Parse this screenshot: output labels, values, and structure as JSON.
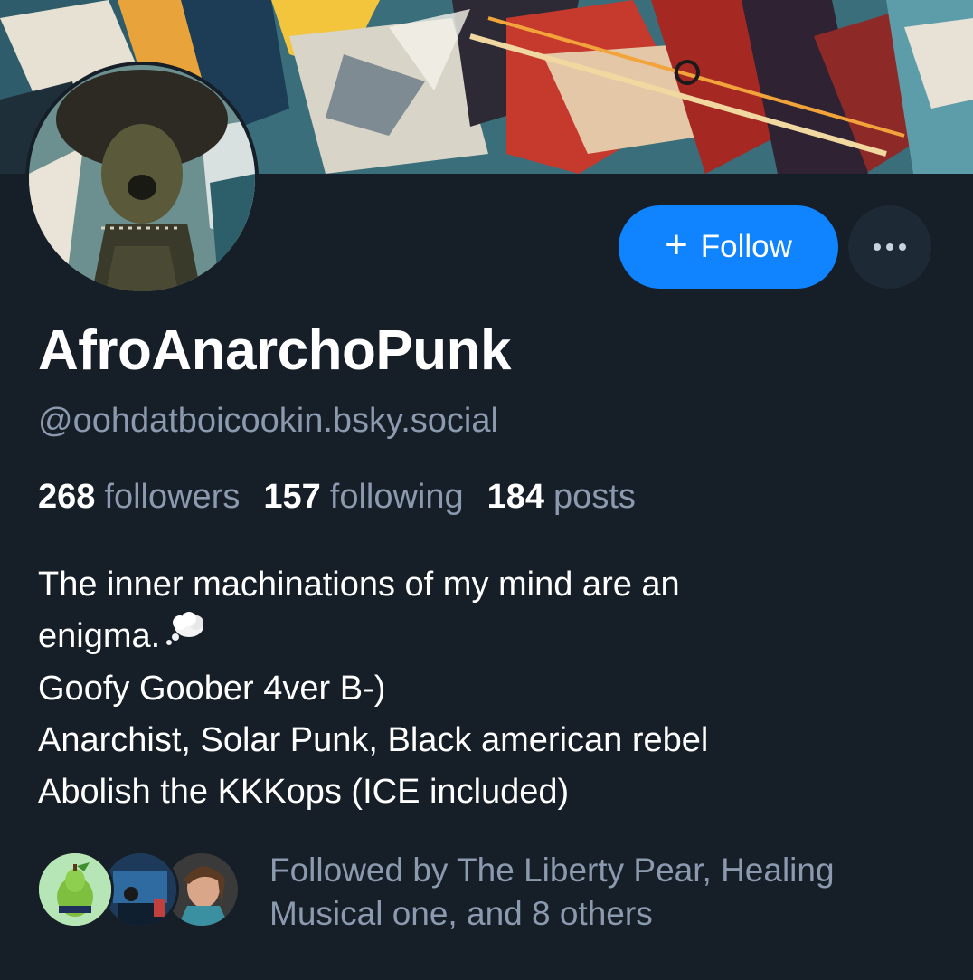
{
  "profile": {
    "display_name": "AfroAnarchoPunk",
    "handle": "@oohdatboicookin.bsky.social"
  },
  "actions": {
    "follow_label": "Follow",
    "more_icon": "ellipsis-icon"
  },
  "stats": {
    "followers_count": "268",
    "followers_label": "followers",
    "following_count": "157",
    "following_label": "following",
    "posts_count": "184",
    "posts_label": "posts"
  },
  "bio": {
    "line1": "The inner machinations of my mind are an",
    "line2": "enigma.",
    "line2_emoji": "thought-balloon-icon",
    "line3": "Goofy Goober 4ver B-)",
    "line4": "Anarchist, Solar Punk, Black american rebel",
    "line5": "Abolish the KKKops (ICE included)"
  },
  "followed_by": {
    "text_line1": "Followed by The Liberty Pear, Healing",
    "text_line2": "Musical one, and 8 others"
  },
  "colors": {
    "background": "#161e27",
    "accent": "#1083fe",
    "muted_text": "#8c9ab0",
    "more_button_bg": "#1e2936"
  }
}
